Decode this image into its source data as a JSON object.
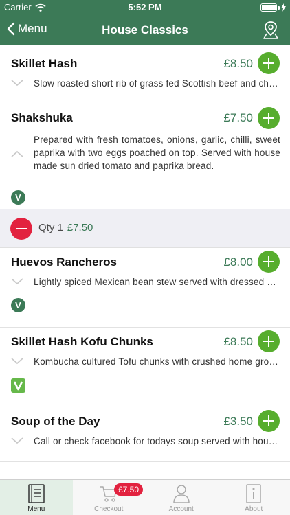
{
  "status_bar": {
    "carrier": "Carrier",
    "time": "5:52 PM"
  },
  "nav": {
    "back_label": "Menu",
    "title": "House Classics"
  },
  "items": [
    {
      "name": "Skillet Hash",
      "price": "£8.50",
      "description": "Slow roasted short rib of grass fed Scottish beef and chorizo hash",
      "expanded": false
    },
    {
      "name": "Shakshuka",
      "price": "£7.50",
      "description": "Prepared with fresh tomatoes, onions, garlic, chilli, sweet paprika with two eggs poached on top. Served with house made sun dried tomato and paprika bread.",
      "expanded": true,
      "badge": "V"
    },
    {
      "name": "Huevos Rancheros",
      "price": "£8.00",
      "description": "Lightly spiced Mexican bean stew served with dressed greens",
      "expanded": false,
      "badge": "V"
    },
    {
      "name": "Skillet Hash Kofu Chunks",
      "price": "£8.50",
      "description": "Kombucha cultured Tofu chunks with crushed home grown potatoes",
      "expanded": false
    },
    {
      "name": "Soup of the Day",
      "price": "£3.50",
      "description": "Call or check facebook for todays soup served with house bread",
      "expanded": false
    }
  ],
  "order_line": {
    "qty_label": "Qty 1",
    "price": "£7.50"
  },
  "tabs": [
    {
      "label": "Menu",
      "icon": "menu-book-icon",
      "active": true
    },
    {
      "label": "Checkout",
      "icon": "cart-icon",
      "active": false
    },
    {
      "label": "Account",
      "icon": "person-icon",
      "active": false
    },
    {
      "label": "About",
      "icon": "info-icon",
      "active": false
    }
  ],
  "cart_badge": "£7.50",
  "colors": {
    "brand_green": "#3c7a57",
    "add_green": "#57ad2e",
    "remove_red": "#e2223f",
    "vegan_green": "#66b84a"
  }
}
